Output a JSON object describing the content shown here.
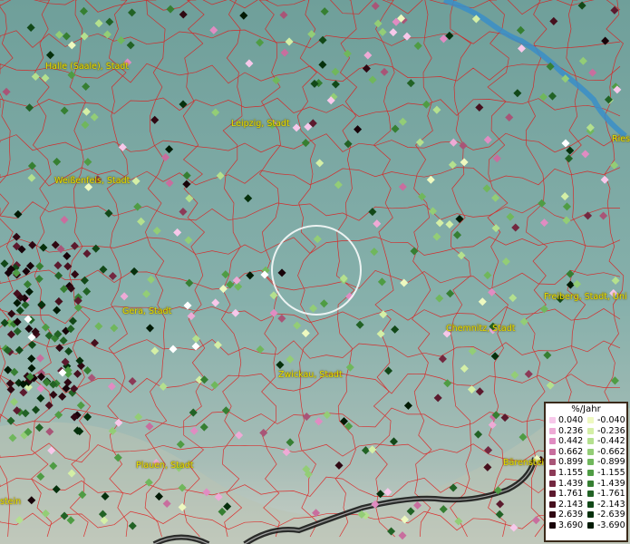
{
  "cities": [
    {
      "name": "Halle (Saale), Stadt"
    },
    {
      "name": "Leipzig, Stadt"
    },
    {
      "name": "Weißenfels, Stadt"
    },
    {
      "name": "Gera, Stadt"
    },
    {
      "name": "Chemnitz, Stadt"
    },
    {
      "name": "Freiberg, Stadt, Uni"
    },
    {
      "name": "Zwickau, Stadt"
    },
    {
      "name": "Plauen, Stadt"
    },
    {
      "name": "Riesa"
    },
    {
      "name": "Bärenstein"
    },
    {
      "name": "stein"
    }
  ],
  "legend": {
    "title": "%/Jahr",
    "positive": [
      {
        "value": "0.040",
        "color": "#f7c8ea"
      },
      {
        "value": "0.236",
        "color": "#eeaad6"
      },
      {
        "value": "0.442",
        "color": "#e08cc2"
      },
      {
        "value": "0.662",
        "color": "#c86e9e"
      },
      {
        "value": "0.899",
        "color": "#a85577"
      },
      {
        "value": "1.155",
        "color": "#8c3a57"
      },
      {
        "value": "1.439",
        "color": "#732840"
      },
      {
        "value": "1.761",
        "color": "#5c1a2e"
      },
      {
        "value": "2.143",
        "color": "#46101e"
      },
      {
        "value": "2.639",
        "color": "#2f0812"
      },
      {
        "value": "3.690",
        "color": "#180309"
      }
    ],
    "negative": [
      {
        "value": "-0.040",
        "color": "#eef9c0"
      },
      {
        "value": "-0.236",
        "color": "#d4efa6"
      },
      {
        "value": "-0.442",
        "color": "#b4e08e"
      },
      {
        "value": "-0.662",
        "color": "#93cd76"
      },
      {
        "value": "-0.899",
        "color": "#70b75c"
      },
      {
        "value": "-1.155",
        "color": "#4f9c44"
      },
      {
        "value": "-1.439",
        "color": "#367f32"
      },
      {
        "value": "-1.761",
        "color": "#226225"
      },
      {
        "value": "-2.143",
        "color": "#124818"
      },
      {
        "value": "-2.639",
        "color": "#06300c"
      },
      {
        "value": "-3.690",
        "color": "#011a04"
      }
    ]
  },
  "colors": {
    "background": "#7fa9a4",
    "borders": "#e01818",
    "river": "#3a8ec8",
    "city_label": "#e8e000",
    "highlight_ring": "#ffffff"
  },
  "icons": {
    "selection_ring": "circle-selection-icon",
    "station_marker": "diamond-marker-icon"
  }
}
